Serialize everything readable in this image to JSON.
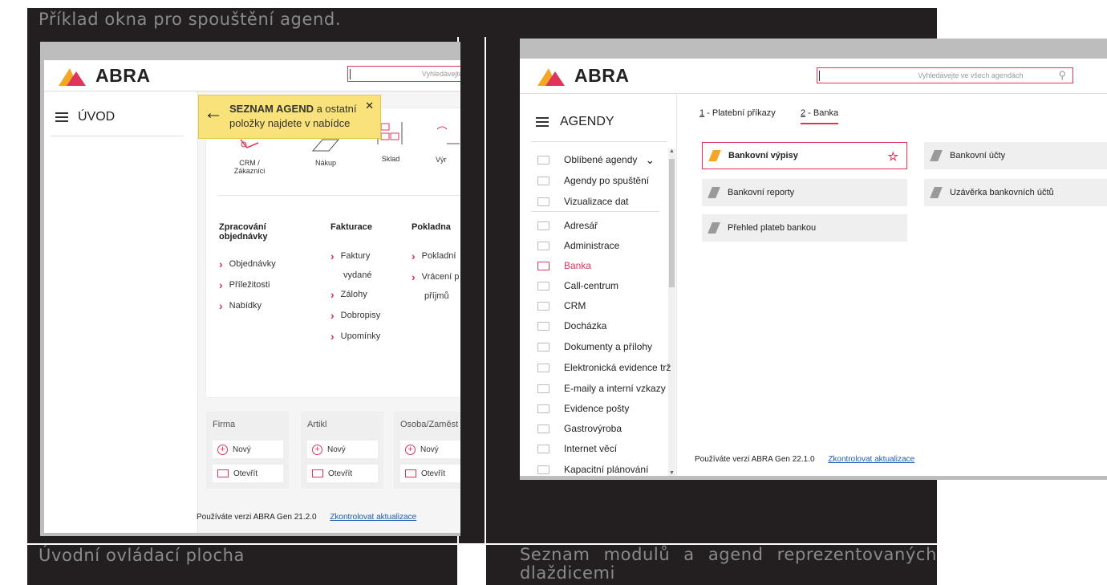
{
  "caption_top": "Příklad okna pro spouštění agend.",
  "caption_left": "Úvodní ovládací plocha",
  "caption_right": "Seznam modulů a agend reprezentovaných dlaždicemi",
  "left": {
    "logo": "ABRA",
    "search_placeholder": "Vyhledávejte v",
    "menu_title": "ÚVOD",
    "tooltip": {
      "bold": "SEZNAM AGEND",
      "rest1": " a ostatní",
      "rest2": "položky najdete v nabídce",
      "close": "✕"
    },
    "tiles": [
      "CRM /",
      "Zákazníci",
      "Nákup",
      "Sklad",
      "Výr"
    ],
    "columns": [
      {
        "title1": "Zpracování",
        "title2": "objednávky",
        "items": [
          "Objednávky",
          "Příležitosti",
          "Nabídky"
        ]
      },
      {
        "title1": "Fakturace",
        "items": [
          "Faktury",
          "vydané",
          "Zálohy",
          "Dobropisy",
          "Upomínky"
        ]
      },
      {
        "title1": "Pokladna",
        "items": [
          "Pokladní",
          "Vrácení p",
          "příjmů"
        ]
      }
    ],
    "cards": [
      {
        "title": "Firma",
        "new": "Nový",
        "open": "Otevřít"
      },
      {
        "title": "Artikl",
        "new": "Nový",
        "open": "Otevřít"
      },
      {
        "title": "Osoba/Zaměst",
        "new": "Nový",
        "open": "Otevřít"
      }
    ],
    "version": "Používáte verzi ABRA Gen 21.2.0",
    "check_link": "Zkontrolovat aktualizace"
  },
  "right": {
    "logo": "ABRA",
    "search_placeholder": "Vyhledávejte ve všech agendách",
    "menu_title": "AGENDY",
    "tabs": [
      {
        "num": "1",
        "label": " - Platební příkazy"
      },
      {
        "num": "2",
        "label": " - Banka"
      }
    ],
    "list": [
      "Oblíbené agendy",
      "Agendy po spuštění",
      "Vizualizace dat",
      "Adresář",
      "Administrace",
      "Banka",
      "Call-centrum",
      "CRM",
      "Docházka",
      "Dokumenty a přílohy",
      "Elektronická evidence trž",
      "E-maily a interní vzkazy",
      "Evidence pošty",
      "Gastrovýroba",
      "Internet věcí",
      "Kapacitní plánování"
    ],
    "agenda_tiles": [
      "Bankovní výpisy",
      "Bankovní účty",
      "Bankovní reporty",
      "Uzávěrka bankovních účtů",
      "Přehled plateb bankou"
    ],
    "version": "Používáte verzi ABRA Gen 22.1.0",
    "check_link": "Zkontrolovat aktualizace"
  },
  "colors": {
    "accent": "#e0355a",
    "dark": "#231f20",
    "tooltip": "#f9e27a"
  }
}
